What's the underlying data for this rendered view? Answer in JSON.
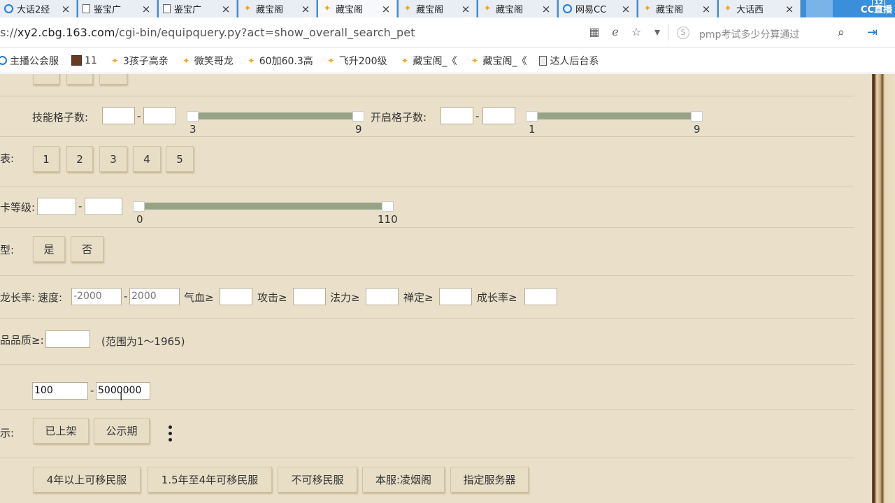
{
  "browser": {
    "tabs": [
      {
        "icon": "cc-icon",
        "label": "大话2经"
      },
      {
        "icon": "doc-icon",
        "label": "鉴宝广"
      },
      {
        "icon": "doc-icon",
        "label": "鉴宝广"
      },
      {
        "icon": "bird-icon",
        "label": "藏宝阁"
      },
      {
        "icon": "bird-icon",
        "label": "藏宝阁"
      },
      {
        "icon": "bird-icon",
        "label": "藏宝阁"
      },
      {
        "icon": "bird-icon",
        "label": "藏宝阁"
      },
      {
        "icon": "cc-icon",
        "label": "网易CC"
      },
      {
        "icon": "bird-icon",
        "label": "藏宝阁"
      },
      {
        "icon": "bird-icon",
        "label": "大话西"
      }
    ],
    "close_glyph": "×",
    "cc_live": {
      "label": "CC直播",
      "badge": "12"
    },
    "url_prefix": "s://",
    "url_host": "xy2.cbg.163.com",
    "url_path": "/cgi-bin/equipquery.py?act=show_overall_search_pet",
    "search_placeholder": "pmp考试多少分算通过",
    "bookmarks": [
      {
        "icon": "cc-icon",
        "label": "主播公会服"
      },
      {
        "icon": "image-icon",
        "label": "11"
      },
      {
        "icon": "bird-icon",
        "label": "3孩子高亲"
      },
      {
        "icon": "bird-icon",
        "label": "微笑哥龙"
      },
      {
        "icon": "bird-icon",
        "label": "60加60.3高"
      },
      {
        "icon": "bird-icon",
        "label": "飞升200级"
      },
      {
        "icon": "bird-icon",
        "label": "藏宝阁_《"
      },
      {
        "icon": "bird-icon",
        "label": "藏宝阁_《"
      },
      {
        "icon": "doc-icon",
        "label": "达人后台系"
      }
    ]
  },
  "form": {
    "skill_slots": {
      "label": "技能格子数:",
      "min": "",
      "max": "",
      "slider_min": "3",
      "slider_max": "9"
    },
    "open_slots": {
      "label": "开启格子数:",
      "min": "",
      "max": "",
      "slider_min": "1",
      "slider_max": "9"
    },
    "row_number": {
      "label": "表:",
      "options": [
        "1",
        "2",
        "3",
        "4",
        "5"
      ]
    },
    "level": {
      "label": "卡等级:",
      "min": "",
      "max": "",
      "slider_min": "0",
      "slider_max": "110"
    },
    "yes_no": {
      "label": "型:",
      "yes": "是",
      "no": "否"
    },
    "growth": {
      "label": "龙长率:",
      "speed_label": "速度:",
      "speed_min": "-2000",
      "speed_max": "2000",
      "hp_label": "气血≥",
      "atk_label": "攻击≥",
      "mag_label": "法力≥",
      "zen_label": "禅定≥",
      "growth_label": "成长率≥"
    },
    "quality": {
      "label": "品品质≥:",
      "hint": "(范围为1～1965)"
    },
    "price": {
      "min": "100",
      "max": "5000000"
    },
    "status": {
      "label": "示:",
      "options": [
        "已上架",
        "公示期"
      ]
    },
    "server": {
      "options": [
        "4年以上可移民服",
        "1.5年至4年可移民服",
        "不可移民服",
        "本服:凌烟阁",
        "指定服务器"
      ]
    }
  }
}
